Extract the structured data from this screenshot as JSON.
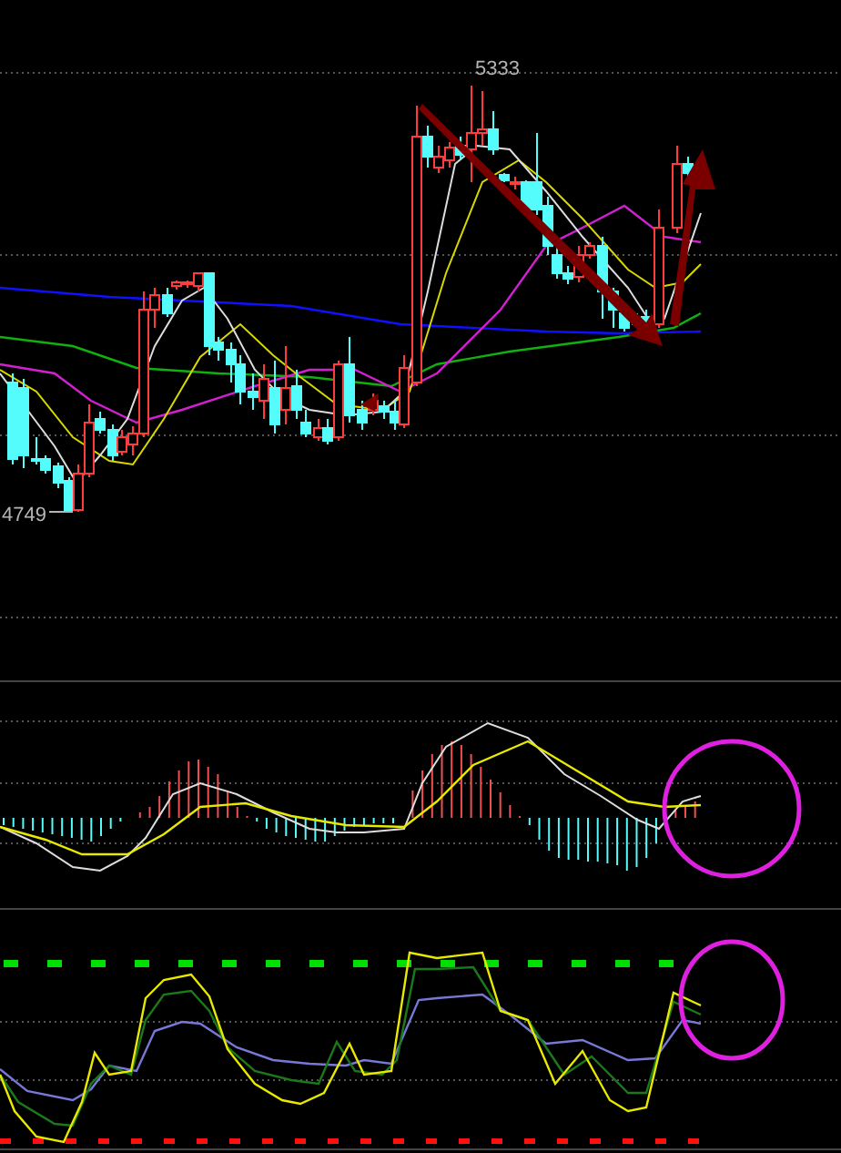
{
  "chart": {
    "high_label": "5333",
    "low_label": "4749"
  }
}
